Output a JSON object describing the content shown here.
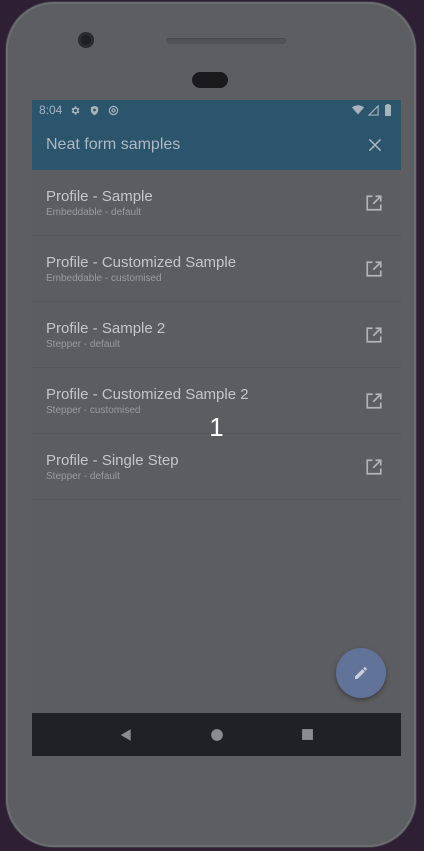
{
  "status_bar": {
    "time": "8:04",
    "icons": [
      "settings-icon",
      "shield-icon",
      "at-icon"
    ],
    "right_icons": [
      "wifi-icon",
      "signal-icon",
      "battery-icon"
    ]
  },
  "app_bar": {
    "title": "Neat form samples",
    "close_icon": "close-icon"
  },
  "samples": [
    {
      "title": "Profile - Sample",
      "subtitle": "Embeddable - default"
    },
    {
      "title": "Profile - Customized Sample",
      "subtitle": "Embeddable - customised"
    },
    {
      "title": "Profile - Sample 2",
      "subtitle": "Stepper - default"
    },
    {
      "title": "Profile - Customized Sample 2",
      "subtitle": "Stepper - customised"
    },
    {
      "title": "Profile - Single Step",
      "subtitle": "Stepper - default"
    }
  ],
  "overlay": {
    "step_number": "1"
  },
  "fab": {
    "icon": "pencil-icon"
  },
  "nav_bar": {
    "icons": [
      "back-icon",
      "home-icon",
      "recents-icon"
    ]
  },
  "colors": {
    "app_bar": "#2b546d",
    "screen_bg": "#5c5d61",
    "fab": "#62739a",
    "nav_bar": "#202124"
  }
}
